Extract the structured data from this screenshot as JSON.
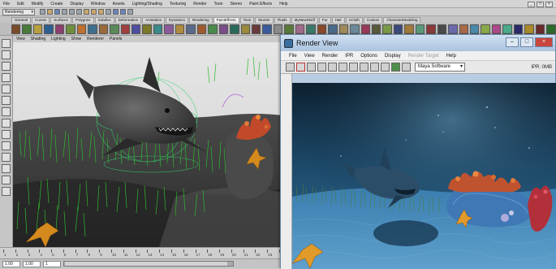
{
  "main_menu": [
    "File",
    "Edit",
    "Modify",
    "Create",
    "Display",
    "Window",
    "Assets",
    "Lighting/Shading",
    "Texturing",
    "Render",
    "Toon",
    "Stereo",
    "Paint Effects",
    "Help"
  ],
  "status_line": {
    "mode": "Rendering"
  },
  "shelf_tabs": [
    "General",
    "Curves",
    "Surfaces",
    "Polygons",
    "Subdivs",
    "Deformation",
    "Animation",
    "Dynamics",
    "Rendering",
    "PaintEffects",
    "Toon",
    "Muscle",
    "Fluids",
    "MyNewShelf",
    "Fur",
    "Hair",
    "nCloth",
    "Custom",
    "CharacterModeling"
  ],
  "shelf_active": "PaintEffects",
  "panel_menu": [
    "View",
    "Shading",
    "Lighting",
    "Show",
    "Renderer",
    "Panels"
  ],
  "time_slider": {
    "ticks": [
      "1",
      "2",
      "3",
      "4",
      "5",
      "6",
      "7",
      "8",
      "9",
      "10",
      "11",
      "12",
      "13",
      "14",
      "15",
      "16",
      "17",
      "18",
      "19",
      "20",
      "21",
      "22",
      "23",
      "24"
    ]
  },
  "range": {
    "start": "1.00",
    "start_inner": "1.00",
    "current": "1"
  },
  "render_view": {
    "title": "Render View",
    "menu": [
      "File",
      "View",
      "Render",
      "IPR",
      "Options",
      "Display",
      "Render Target",
      "Help"
    ],
    "renderer": "Maya Software",
    "ipr_label": "IPR: 0MB"
  },
  "colors": {
    "viewport_grey": "#3a3a3a",
    "render_water": "#1d4a6b",
    "render_sand": "#2e6e9a",
    "grass": "#2db82d",
    "title_bar": "#b9cfe8"
  }
}
